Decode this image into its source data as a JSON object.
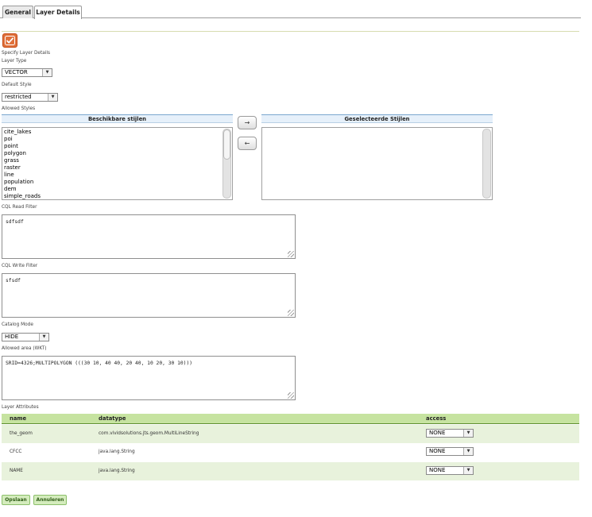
{
  "tabs": [
    {
      "label": "General"
    },
    {
      "label": "Layer Details"
    }
  ],
  "specify_label": "Specify Layer Details",
  "layer_type": {
    "label": "Layer Type",
    "value": "VECTOR"
  },
  "default_style": {
    "label": "Default Style",
    "value": "restricted"
  },
  "allowed_styles": {
    "label": "Allowed Styles",
    "available_header": "Beschikbare stijlen",
    "selected_header": "Geselecteerde Stijlen",
    "available": [
      "cite_lakes",
      "poi",
      "point",
      "polygon",
      "grass",
      "raster",
      "line",
      "population",
      "dem",
      "simple_roads"
    ],
    "add_symbol": "→",
    "remove_symbol": "←"
  },
  "cql_read": {
    "label": "CQL Read Filter",
    "value": "sdfsdf"
  },
  "cql_write": {
    "label": "CQL Write Filter",
    "value": "sfsdf"
  },
  "catalog_mode": {
    "label": "Catalog Mode",
    "value": "HIDE"
  },
  "allowed_area": {
    "label": "Allowed area (WKT)",
    "value": "SRID=4326;MULTIPOLYGON (((30 10, 40 40, 20 40, 10 20, 30 10)))"
  },
  "attributes": {
    "label": "Layer Attributes",
    "headers": {
      "name": "name",
      "datatype": "datatype",
      "access": "access"
    },
    "rows": [
      {
        "name": "the_geom",
        "datatype": "com.vividsolutions.jts.geom.MultiLineString",
        "access": "NONE"
      },
      {
        "name": "CFCC",
        "datatype": "java.lang.String",
        "access": "NONE"
      },
      {
        "name": "NAME",
        "datatype": "java.lang.String",
        "access": "NONE"
      }
    ]
  },
  "buttons": {
    "save": "Opslaan",
    "cancel": "Annuleren"
  },
  "colors": {
    "accent": "#e0703a",
    "table_header": "#c6e3a0",
    "row_alt": "#e8f2dc"
  }
}
